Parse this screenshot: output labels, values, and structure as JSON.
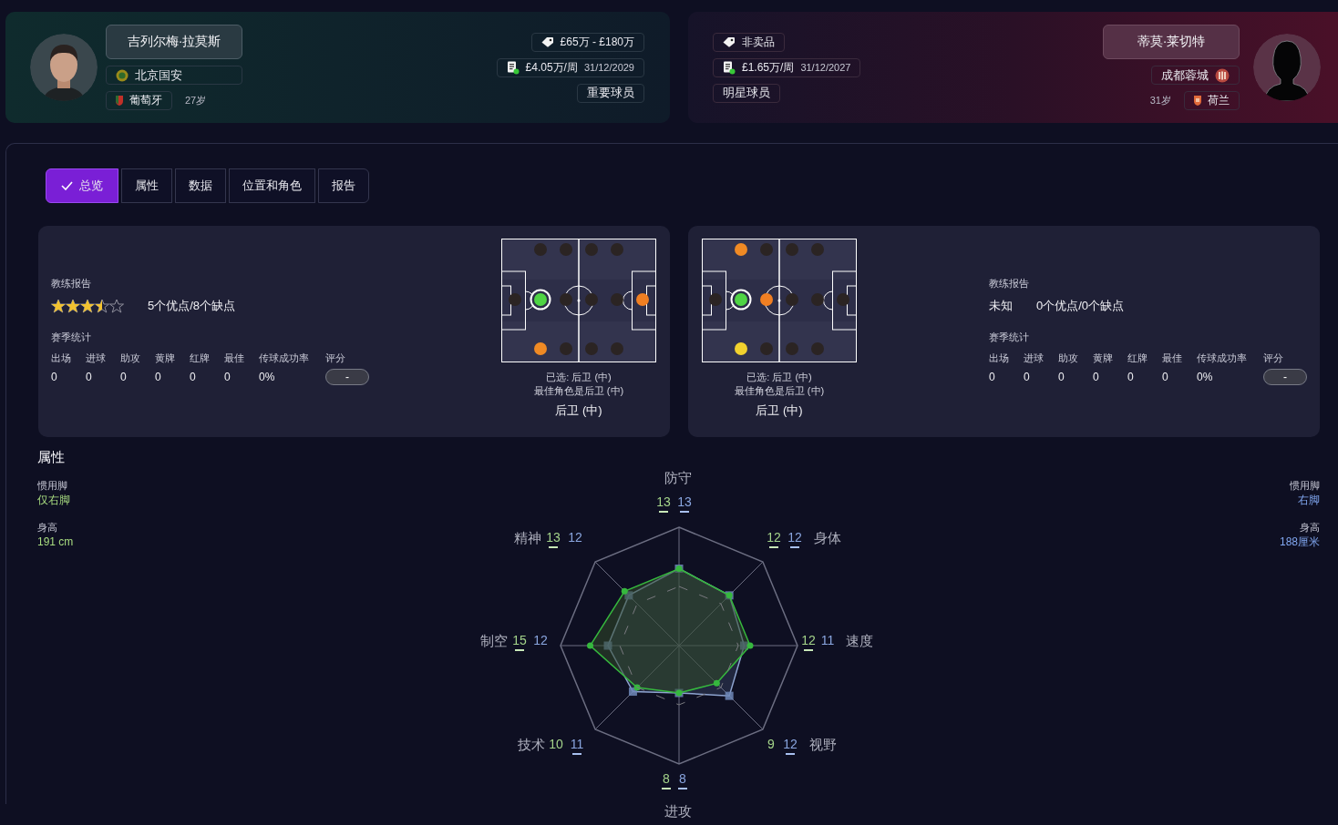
{
  "players": [
    {
      "name": "吉列尔梅·拉莫斯",
      "club": "北京国安",
      "nationality": "葡萄牙",
      "age": "27岁",
      "value": "£65万 - £180万",
      "wage": "£4.05万/周",
      "contract_end": "31/12/2029",
      "status": "重要球员"
    },
    {
      "name": "蒂莫·莱切特",
      "club": "成都蓉城",
      "nationality": "荷兰",
      "age": "31岁",
      "value": "非卖品",
      "wage": "£1.65万/周",
      "contract_end": "31/12/2027",
      "status": "明星球员"
    }
  ],
  "tabs": [
    {
      "label": "总览",
      "selected": true
    },
    {
      "label": "属性",
      "selected": false
    },
    {
      "label": "数据",
      "selected": false
    },
    {
      "label": "位置和角色",
      "selected": false
    },
    {
      "label": "报告",
      "selected": false
    }
  ],
  "reports": [
    {
      "coach_report_label": "教练报告",
      "kind": "stars",
      "stars": 3.5,
      "strengths": "5个优点/8个缺点",
      "season_label": "赛季统计",
      "stat_headers": [
        "出场",
        "进球",
        "助攻",
        "黄牌",
        "红牌",
        "最佳",
        "传球成功率",
        "评分"
      ],
      "stat_values": [
        "0",
        "0",
        "0",
        "0",
        "0",
        "0",
        "0%"
      ],
      "rating": "-",
      "pitch": {
        "slots": [
          {
            "color": "#2b2423",
            "selected": false
          },
          {
            "color": "#2b2423",
            "selected": false
          },
          {
            "color": "#2b2423",
            "selected": false
          },
          {
            "color": "#2b2423",
            "selected": false
          },
          {
            "color": "#2b2423",
            "selected": false
          },
          {
            "color": "#4fd444",
            "selected": true
          },
          {
            "color": "#2b2423",
            "selected": false
          },
          {
            "color": "#2b2423",
            "selected": false
          },
          {
            "color": "#2b2423",
            "selected": false
          },
          {
            "color": "#f07f22",
            "selected": false
          },
          {
            "color": "#f08a24",
            "selected": false
          },
          {
            "color": "#2b2423",
            "selected": false
          },
          {
            "color": "#2b2423",
            "selected": false
          },
          {
            "color": "#2b2423",
            "selected": false
          }
        ],
        "selected_role": "已选: 后卫 (中)",
        "best_role": "最佳角色是后卫 (中)",
        "position": "后卫 (中)"
      }
    },
    {
      "coach_report_label": "教练报告",
      "kind": "unknown",
      "verdict": "未知",
      "strengths": "0个优点/0个缺点",
      "season_label": "赛季统计",
      "stat_headers": [
        "出场",
        "进球",
        "助攻",
        "黄牌",
        "红牌",
        "最佳",
        "传球成功率",
        "评分"
      ],
      "stat_values": [
        "0",
        "0",
        "0",
        "0",
        "0",
        "0",
        "0%"
      ],
      "rating": "-",
      "pitch": {
        "slots": [
          {
            "color": "#f08a24",
            "selected": false
          },
          {
            "color": "#2b2423",
            "selected": false
          },
          {
            "color": "#2b2423",
            "selected": false
          },
          {
            "color": "#2b2423",
            "selected": false
          },
          {
            "color": "#2b2423",
            "selected": false
          },
          {
            "color": "#4fd444",
            "selected": true
          },
          {
            "color": "#f07f22",
            "selected": false
          },
          {
            "color": "#2b2423",
            "selected": false
          },
          {
            "color": "#2b2423",
            "selected": false
          },
          {
            "color": "#2b2423",
            "selected": false
          },
          {
            "color": "#f2d22e",
            "selected": false
          },
          {
            "color": "#2b2423",
            "selected": false
          },
          {
            "color": "#2b2423",
            "selected": false
          },
          {
            "color": "#2b2423",
            "selected": false
          }
        ],
        "selected_role": "已选: 后卫 (中)",
        "best_role": "最佳角色是后卫 (中)",
        "position": "后卫 (中)"
      }
    }
  ],
  "attributes": {
    "title": "属性",
    "players": [
      {
        "foot_label": "惯用脚",
        "foot": "仅右脚",
        "height_label": "身高",
        "height": "191 cm"
      },
      {
        "foot_label": "惯用脚",
        "foot": "右脚",
        "height_label": "身高",
        "height": "188厘米"
      }
    ],
    "radar": {
      "axes": [
        {
          "label": "防守",
          "a": "13",
          "b": "13",
          "a_underlined": true,
          "b_underlined": true
        },
        {
          "label": "身体",
          "a": "12",
          "b": "12",
          "a_underlined": true,
          "b_underlined": true
        },
        {
          "label": "速度",
          "a": "12",
          "b": "11",
          "a_underlined": true,
          "b_underlined": false
        },
        {
          "label": "视野",
          "a": "9",
          "b": "12",
          "a_underlined": false,
          "b_underlined": true
        },
        {
          "label": "进攻",
          "a": "8",
          "b": "8",
          "a_underlined": true,
          "b_underlined": true
        },
        {
          "label": "技术",
          "a": "10",
          "b": "11",
          "a_underlined": false,
          "b_underlined": true
        },
        {
          "label": "制空",
          "a": "15",
          "b": "12",
          "a_underlined": true,
          "b_underlined": false
        },
        {
          "label": "精神",
          "a": "13",
          "b": "12",
          "a_underlined": true,
          "b_underlined": false
        }
      ]
    }
  }
}
